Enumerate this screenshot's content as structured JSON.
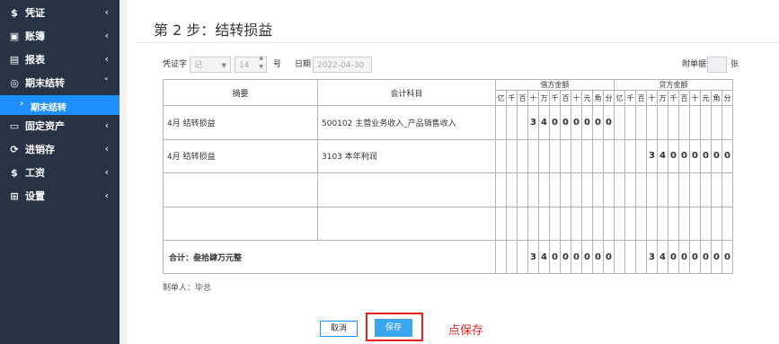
{
  "sidebar": {
    "items": [
      {
        "icon": "$",
        "label": "凭证",
        "chevron": "‹"
      },
      {
        "icon": "▣",
        "label": "账簿",
        "chevron": "‹"
      },
      {
        "icon": "▤",
        "label": "报表",
        "chevron": "‹"
      },
      {
        "icon": "◎",
        "label": "期末结转",
        "chevron": "˅"
      },
      {
        "icon": "▭",
        "label": "固定资产",
        "chevron": "‹"
      },
      {
        "icon": "⟳",
        "label": "进销存",
        "chevron": "‹"
      },
      {
        "icon": "$",
        "label": "工资",
        "chevron": "‹"
      },
      {
        "icon": "⊞",
        "label": "设置",
        "chevron": "‹"
      }
    ],
    "sub_item": {
      "bullet": "›",
      "label": "期末结转"
    }
  },
  "main": {
    "step_title": "第 2 步：结转损益",
    "voucher": {
      "type_label": "凭证字",
      "type_value": "记",
      "number_value": "14",
      "number_suffix": "号",
      "date_label": "日期",
      "date_value": "2022-04-30",
      "attachment_label": "附单据",
      "attachment_unit": "张"
    },
    "table": {
      "col_summary": "摘要",
      "col_subject": "会计科目",
      "col_debit": "借方金额",
      "col_credit": "贷方金额",
      "digit_headers": [
        "亿",
        "千",
        "百",
        "十",
        "万",
        "千",
        "百",
        "十",
        "元",
        "角",
        "分"
      ],
      "rows": [
        {
          "summary": "4月 结转损益",
          "subject": "500102 主营业务收入_产品销售收入",
          "debit": [
            "",
            "",
            "",
            "3",
            "4",
            "0",
            "0",
            "0",
            "0",
            "0",
            "0"
          ],
          "credit": [
            "",
            "",
            "",
            "",
            "",
            "",
            "",
            "",
            "",
            "",
            ""
          ]
        },
        {
          "summary": "4月 结转损益",
          "subject": "3103 本年利润",
          "debit": [
            "",
            "",
            "",
            "",
            "",
            "",
            "",
            "",
            "",
            "",
            ""
          ],
          "credit": [
            "",
            "",
            "",
            "3",
            "4",
            "0",
            "0",
            "0",
            "0",
            "0",
            "0"
          ]
        },
        {
          "summary": "",
          "subject": "",
          "debit": [
            "",
            "",
            "",
            "",
            "",
            "",
            "",
            "",
            "",
            "",
            ""
          ],
          "credit": [
            "",
            "",
            "",
            "",
            "",
            "",
            "",
            "",
            "",
            "",
            ""
          ]
        },
        {
          "summary": "",
          "subject": "",
          "debit": [
            "",
            "",
            "",
            "",
            "",
            "",
            "",
            "",
            "",
            "",
            ""
          ],
          "credit": [
            "",
            "",
            "",
            "",
            "",
            "",
            "",
            "",
            "",
            "",
            ""
          ]
        }
      ],
      "total_label": "合计：叁拾肆万元整",
      "total_debit": [
        "",
        "",
        "",
        "3",
        "4",
        "0",
        "0",
        "0",
        "0",
        "0",
        "0"
      ],
      "total_credit": [
        "",
        "",
        "",
        "3",
        "4",
        "0",
        "0",
        "0",
        "0",
        "0",
        "0"
      ]
    },
    "maker": "制单人：毕总",
    "cancel_label": "取消",
    "save_label": "保存",
    "annotation": "点保存"
  }
}
